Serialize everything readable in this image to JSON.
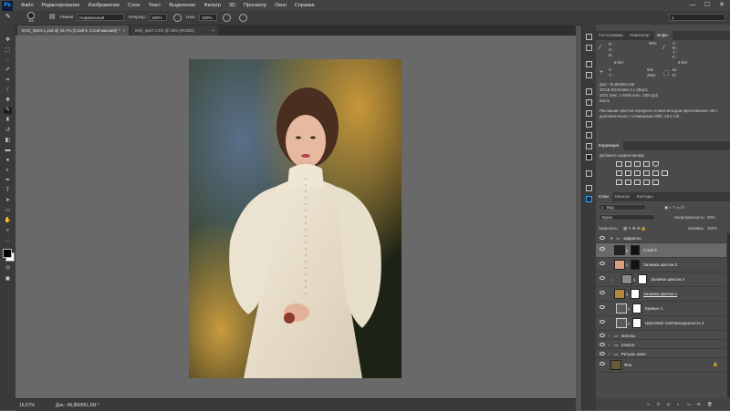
{
  "app": {
    "logo": "Ps"
  },
  "menu": [
    "Файл",
    "Редактирование",
    "Изображение",
    "Слои",
    "Текст",
    "Выделение",
    "Фильтр",
    "3D",
    "Просмотр",
    "Окно",
    "Справка"
  ],
  "window_controls": {
    "minimize": "—",
    "maximize": "☐",
    "close": "✕"
  },
  "options": {
    "brush_size": "300",
    "mode_label": "Режим:",
    "mode_value": "Нормальный",
    "opacity_label": "Непрозр.:",
    "opacity_value": "100%",
    "flow_label": "Наж.:",
    "flow_value": "100%",
    "workspace_value": "1"
  },
  "tools": [
    "move-icon",
    "marquee-icon",
    "lasso-icon",
    "quick-select-icon",
    "crop-icon",
    "eyedropper-icon",
    "healing-icon",
    "brush-icon",
    "stamp-icon",
    "history-brush-icon",
    "eraser-icon",
    "gradient-icon",
    "blur-icon",
    "dodge-icon",
    "pen-icon",
    "type-icon",
    "path-select-icon",
    "shape-icon",
    "hand-icon",
    "zoom-icon"
  ],
  "tabs": [
    {
      "label": "EVG_5934-1.psd @ 16,7% (Слой 6, Слой-маска/8) *",
      "close": "×"
    },
    {
      "label": "IMG_6837.CR2 @ 25% (RGB/8)",
      "close": "×"
    }
  ],
  "status": {
    "zoom": "16,67%",
    "doc": "Док.: 46,8M/851,6M"
  },
  "info_panel": {
    "tabs": [
      "Гистограмма",
      "Навигатор",
      "Инфо"
    ],
    "r_label": "R :",
    "g_label": "G :",
    "b_label": "B :",
    "c_label": "C :",
    "m_label": "M :",
    "y_label": "Y :",
    "k_label": "K :",
    "c_value": "99%",
    "bit1": "8-бит",
    "bit2": "8-бит",
    "x_label": "X :",
    "y2_label": "Y :",
    "x_value": "",
    "w_label": "Ш :",
    "w_value": "942",
    "h_label": "В :",
    "h_value": "2604",
    "doc_line1": "Док.: 46,8M/851,6M",
    "doc_line2": "sRGB IEC61966-2.1 (8bpc)",
    "doc_line3": "3372 пикс. x 5058 пикс. (300 ppi)",
    "doc_line4": "Кисть",
    "hint_line1": "Рисование цветом переднего плана методом притягивания. Исп.",
    "hint_line2": "дополнительно: с клавишами Shift, Alt и Ctrl."
  },
  "adjustments": {
    "tab": "Коррекция",
    "subtitle": "Добавить корректировку"
  },
  "layers_panel": {
    "tabs": [
      "Слои",
      "Каналы",
      "Контуры"
    ],
    "filter_label": "Вид",
    "blend_mode": "Экран",
    "opacity_label": "Непрозрачность:",
    "opacity_value": "30%",
    "lock_label": "Закрепить:",
    "fill_label": "Заливка:",
    "fill_value": "100%",
    "layers": [
      {
        "name": "эффекты",
        "type": "group"
      },
      {
        "name": "Слой 6",
        "type": "layer",
        "selected": true
      },
      {
        "name": "Заливка цветом 3",
        "type": "fill",
        "color": "#d9a080"
      },
      {
        "name": "Заливка цветом 2",
        "type": "fill",
        "color": "#8a8a8a"
      },
      {
        "name": "Заливка цветом 1",
        "type": "fill",
        "color": "#b5893a"
      },
      {
        "name": "Кривые 1",
        "type": "adjust"
      },
      {
        "name": "Цветовой тон/Насыщенность 1",
        "type": "adjust"
      },
      {
        "name": "волосы",
        "type": "group"
      },
      {
        "name": "платье",
        "type": "group"
      },
      {
        "name": "Ретушь кожи",
        "type": "group"
      },
      {
        "name": "Фон",
        "type": "background"
      }
    ]
  },
  "colors": {
    "accent": "#31a8ff",
    "panel_bg": "#4a4a4a",
    "canvas_bg": "#696969",
    "selected_layer": "#6a6a6a"
  }
}
